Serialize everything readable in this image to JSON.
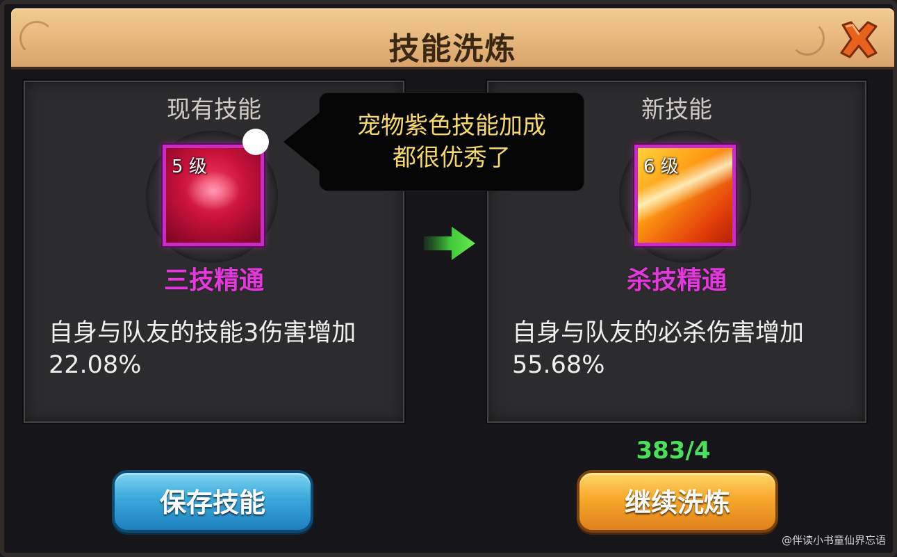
{
  "title": "技能洗炼",
  "current": {
    "header": "现有技能",
    "level": "5 级",
    "name": "三技精通",
    "description": "自身与队友的技能3伤害增加22.08%"
  },
  "new": {
    "header": "新技能",
    "level": "6 级",
    "name": "杀技精通",
    "description": "自身与队友的必杀伤害增加55.68%"
  },
  "tooltip": {
    "line1": "宠物紫色技能加成",
    "line2": "都很优秀了"
  },
  "counter": "383/4",
  "buttons": {
    "save": "保存技能",
    "continue": "继续洗炼"
  },
  "watermark": "@伴读小书童仙界忘语",
  "colors": {
    "skill_name": "#e03ad8",
    "counter": "#4be05a",
    "tooltip_text": "#f6d96a"
  },
  "icons": {
    "close": "close-x-icon",
    "arrow": "green-arrow-right-icon"
  }
}
